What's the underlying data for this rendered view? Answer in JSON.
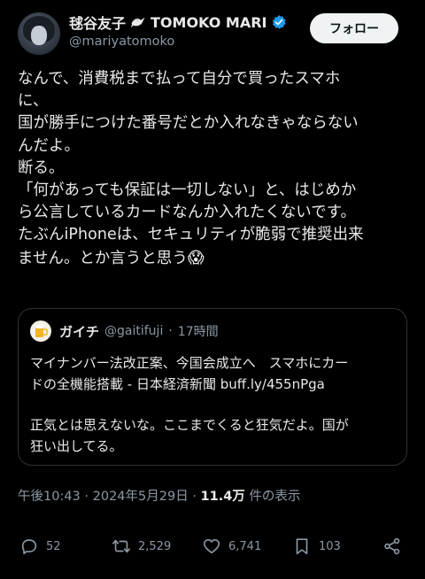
{
  "user": {
    "name": "毬谷友子",
    "name_latin": "TOMOKO MARI",
    "handle": "@mariyatomoko",
    "follow_label": "フォロー"
  },
  "tweet": {
    "lines": [
      "なんで、消費税まで払って自分で買ったスマホ",
      "に、",
      "国が勝手につけた番号だとか入れなきゃならない",
      "んだよ。",
      "断る。",
      "「何があっても保証は一切しない」と、はじめか",
      "ら公言しているカードなんか入れたくないです。",
      "たぶんiPhoneは、セキュリティが脆弱で推奨出来",
      "ません。とか言うと思う"
    ],
    "emoji": "😱"
  },
  "quote": {
    "name": "ガイチ",
    "handle": "@gaitifuji",
    "separator": "·",
    "time": "17時間",
    "lines": [
      "マイナンバー法改正案、今国会成立へ　スマホにカー",
      "ドの全機能搭載 - 日本経済新聞 buff.ly/455nPga"
    ],
    "lines2": [
      "正気とは思えないな。ここまでくると狂気だよ。国が",
      "狂い出してる。"
    ]
  },
  "meta": {
    "time": "午後10:43",
    "separator": "·",
    "date": "2024年5月29日",
    "separator2": "·",
    "views": "11.4万",
    "views_label": "件の表示"
  },
  "actions": {
    "replies": "52",
    "retweets": "2,529",
    "likes": "6,741",
    "bookmarks": "103"
  },
  "colors": {
    "background": "#000000",
    "text": "#e7e9ea",
    "secondary": "#8b98a5",
    "verified": "#1d9bf0",
    "border": "#2f3336"
  }
}
